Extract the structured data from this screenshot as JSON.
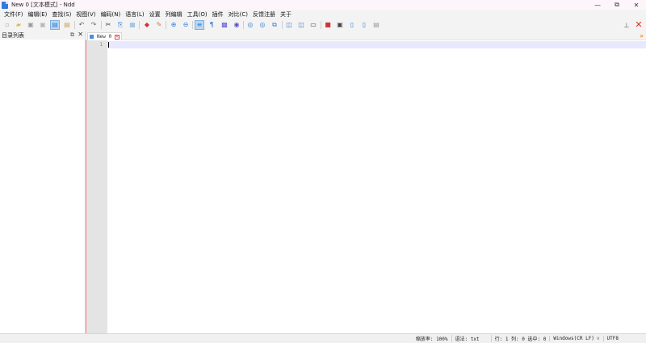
{
  "window": {
    "title": "New 0 [文本模式] - Ndd",
    "controls": {
      "minimize": "—",
      "maximize": "⧉",
      "close": "✕"
    }
  },
  "menu": [
    "文件(F)",
    "编辑(E)",
    "查找(S)",
    "视图(V)",
    "编码(N)",
    "语言(L)",
    "设置",
    "列编辑",
    "工具(O)",
    "插件",
    "对比(C)",
    "反馈注册",
    "关于"
  ],
  "toolbar": {
    "icons": [
      {
        "name": "new-file-icon",
        "glyph": "▫",
        "color": "#b0b0b0"
      },
      {
        "name": "open-file-icon",
        "glyph": "▰",
        "color": "#e5b84a"
      },
      {
        "name": "save-icon",
        "glyph": "▣",
        "color": "#9a9a9a"
      },
      {
        "name": "save-all-icon",
        "glyph": "▣",
        "color": "#b5b5b5"
      },
      {
        "name": "close-file-icon",
        "glyph": "▤",
        "color": "#3a7fd4"
      },
      {
        "name": "close-all-icon",
        "glyph": "▤",
        "color": "#c9a060"
      },
      {
        "name": "print-icon",
        "glyph": "▥",
        "color": "#8ab4e0"
      },
      {
        "name": "undo-icon",
        "glyph": "↶",
        "color": "#666666"
      },
      {
        "name": "redo-icon",
        "glyph": "↷",
        "color": "#666666"
      },
      {
        "name": "cut-icon",
        "glyph": "✂",
        "color": "#444444"
      },
      {
        "name": "copy-icon",
        "glyph": "⎘",
        "color": "#3a7fd4"
      },
      {
        "name": "paste-icon",
        "glyph": "▦",
        "color": "#8ab4e0"
      },
      {
        "name": "mark-icon",
        "glyph": "◆",
        "color": "#d2323c"
      },
      {
        "name": "clear-mark-icon",
        "glyph": "✎",
        "color": "#c0804a"
      },
      {
        "name": "zoom-in-icon",
        "glyph": "⊕",
        "color": "#3a7fd4"
      },
      {
        "name": "zoom-out-icon",
        "glyph": "⊖",
        "color": "#3a7fd4"
      },
      {
        "name": "wrap-icon",
        "glyph": "≡",
        "color": "#3a7fd4"
      },
      {
        "name": "show-symbols-icon",
        "glyph": "¶",
        "color": "#3a7fd4"
      },
      {
        "name": "indent-guide-icon",
        "glyph": "▩",
        "color": "#5a50c8"
      },
      {
        "name": "macro-icon",
        "glyph": "◉",
        "color": "#5a50c8"
      },
      {
        "name": "record-icon",
        "glyph": "◎",
        "color": "#3a7fd4"
      },
      {
        "name": "play-icon",
        "glyph": "◎",
        "color": "#3a7fd4"
      },
      {
        "name": "compare-icon",
        "glyph": "⧉",
        "color": "#3a7fd4"
      },
      {
        "name": "dir-compare-icon",
        "glyph": "◫",
        "color": "#3a7fd4"
      },
      {
        "name": "file-compare-icon",
        "glyph": "◫",
        "color": "#3a7fd4"
      },
      {
        "name": "monitor-icon",
        "glyph": "▭",
        "color": "#444444"
      },
      {
        "name": "stop-icon",
        "glyph": "■",
        "color": "#d2323c"
      },
      {
        "name": "square-icon",
        "glyph": "▣",
        "color": "#444444"
      },
      {
        "name": "panel-icon",
        "glyph": "▯",
        "color": "#3a7fd4"
      },
      {
        "name": "hex-icon",
        "glyph": "▯",
        "color": "#3a7fd4"
      },
      {
        "name": "settings-doc-icon",
        "glyph": "▤",
        "color": "#9a9a9a"
      }
    ],
    "pin_glyph": "⊥",
    "close_glyph": "✕"
  },
  "sidepanel": {
    "title": "目录列表",
    "float_glyph": "⧉",
    "close_glyph": "✕"
  },
  "tab": {
    "label": "New 0",
    "close_glyph": "✕",
    "more_glyph": "»"
  },
  "editor": {
    "line_number": "1"
  },
  "status": {
    "zoom": "缩放率: 100%",
    "syntax": "语法: txt",
    "position": "行: 1 列: 0 选中: 0",
    "line_ending": "Windows(CR LF)",
    "line_ending_arrow": "∨",
    "encoding": "UTF8"
  },
  "colors": {
    "accent": "#2f7de1",
    "current_line": "#e8e8ff",
    "close_red": "#dd3322"
  }
}
